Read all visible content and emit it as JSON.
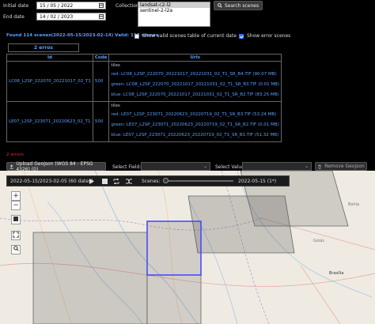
{
  "filters": {
    "initial_date_label": "Initial date",
    "initial_date_value": "15 / 05 / 2022",
    "end_date_label": "End date",
    "end_date_value": "14 / 02 / 2023",
    "collections_label": "Collections:",
    "collections_options": [
      "landsat-c2-l2",
      "sentinel-2-l2a"
    ],
    "search_button": "Search scenes"
  },
  "status": {
    "found_text": "Found 114 scenes(2022-05-15/2023-02-14) Valid: 112 scenes",
    "show_valid_label": "Show valid scenes table of current date",
    "show_errors_label": "Show error scenes"
  },
  "errors_table": {
    "title": "2 erros",
    "headers": [
      "Id",
      "Code",
      "Urls"
    ],
    "rows": [
      {
        "id": "LC08_L2SP_222070_20221017_02_T1",
        "code": "500",
        "tiles_label": "tiles",
        "tiles": [
          {
            "band": "red:",
            "file": "LC08_L2SP_222070_20221017_20221031_02_T1_SR_B4.TIF",
            "size": "(90.07 MB)"
          },
          {
            "band": "green:",
            "file": "LC08_L2SP_222070_20221017_20221031_02_T1_SR_B3.TIF",
            "size": "(0.01 MB)"
          },
          {
            "band": "blue:",
            "file": "LC08_L2SP_222070_20221017_20221031_02_T1_SR_B2.TIF",
            "size": "(83.25 MB)"
          }
        ]
      },
      {
        "id": "LE07_L2SP_223071_20220623_02_T1",
        "code": "500",
        "tiles_label": "tiles",
        "tiles": [
          {
            "band": "red:",
            "file": "LE07_L2SP_223071_20220623_20220719_02_T1_SR_B3.TIF",
            "size": "(53.24 MB)"
          },
          {
            "band": "green:",
            "file": "LE07_L2SP_223071_20220623_20220719_02_T1_SR_B2.TIF",
            "size": "(0.01 MB)"
          },
          {
            "band": "blue:",
            "file": "LE07_L2SP_223071_20220623_20220719_02_T1_SR_B1.TIF",
            "size": "(51.32 MB)"
          }
        ]
      }
    ]
  },
  "errors_summary": "2 errors",
  "toolbar": {
    "upload_button": "Upload Geojson (WGS 84 - EPSG 4326) (0)",
    "select_field_label": "Select Field:",
    "select_value_label": "Select Value:",
    "remove_button": "Remove Geojson"
  },
  "timeline": {
    "range_text": "2022-05-15/2023-02-05 (60 dates)",
    "scenes_label": "Scenes:",
    "current_text": "2022-05-15 (1*)",
    "slider_fraction": 0.0
  },
  "map": {
    "zoom_in": "+",
    "zoom_out": "−",
    "labels": {
      "brasilia": "Brasília",
      "goias": "Goiás",
      "bahia": "Bahia"
    }
  },
  "colors": {
    "accent_blue": "#5aa0ff",
    "error_red": "#e03030",
    "selection_box": "#4a4aff"
  }
}
